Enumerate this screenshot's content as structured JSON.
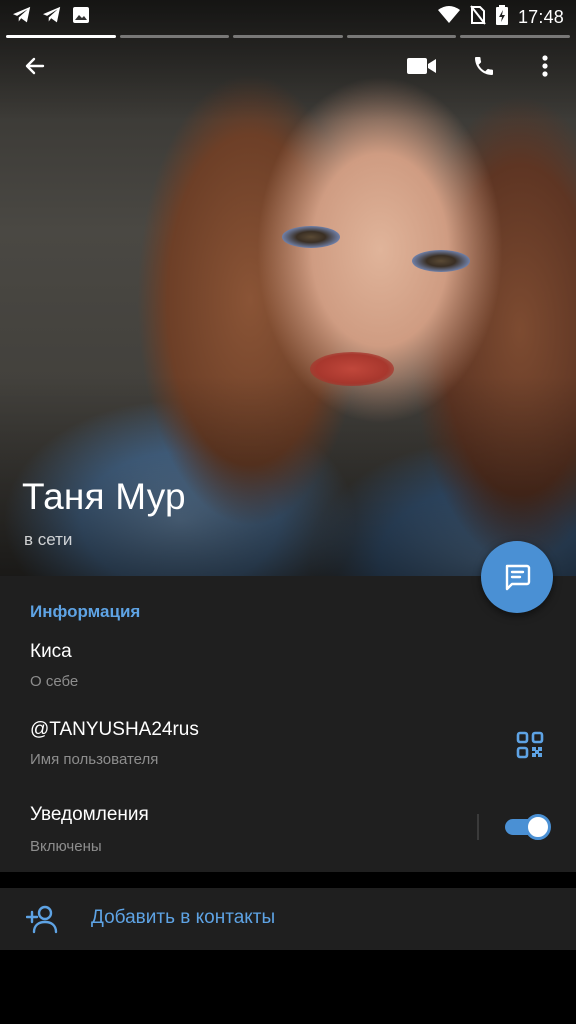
{
  "status_bar": {
    "time": "17:48",
    "left_icons": [
      "telegram-icon",
      "telegram-icon",
      "image-icon"
    ],
    "right_icons": [
      "wifi-icon",
      "no-sim-icon",
      "battery-charging-icon"
    ]
  },
  "stories": {
    "segments": 5,
    "active_index": 0
  },
  "toolbar": {
    "back_icon": "arrow-back-icon",
    "video_call_icon": "video-camera-icon",
    "call_icon": "phone-icon",
    "menu_icon": "more-vertical-icon"
  },
  "profile": {
    "name": "Таня Мур",
    "status": "в сети"
  },
  "fab": {
    "icon": "message-icon"
  },
  "info": {
    "title": "Информация",
    "bio": {
      "value": "Киса",
      "label": "О себе"
    },
    "username": {
      "value": "@TANYUSHA24rus",
      "label": "Имя пользователя",
      "icon": "qr-code-icon"
    },
    "notifications": {
      "value": "Уведомления",
      "label": "Включены",
      "enabled": true
    }
  },
  "add_contact": {
    "label": "Добавить в контакты",
    "icon": "add-user-icon"
  },
  "colors": {
    "accent": "#4a90d4",
    "accent_text": "#5ea3e4",
    "section_bg": "#1f1f1f",
    "secondary_text": "#8d8d8d"
  }
}
